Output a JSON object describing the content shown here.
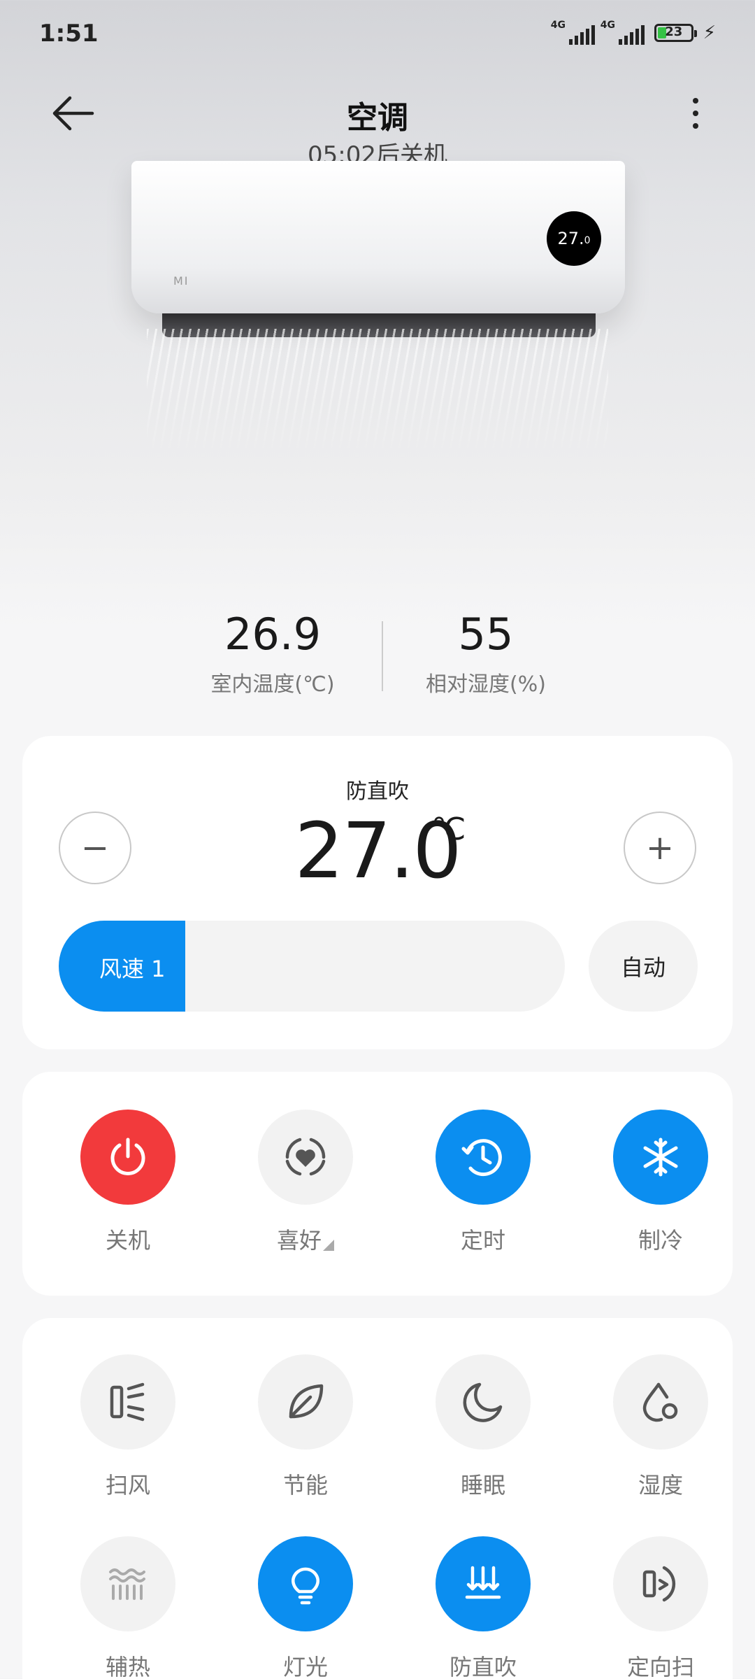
{
  "status_bar": {
    "time": "1:51",
    "signal_label_1": "4G",
    "signal_label_2": "4G",
    "battery": "23"
  },
  "header": {
    "title": "空调",
    "subtitle": "05:02后关机"
  },
  "ac_unit": {
    "brand": "MI",
    "display_temp": "27.",
    "display_temp_decimal": "0"
  },
  "readings": {
    "indoor_temp": {
      "value": "26.9",
      "label": "室内温度(℃)"
    },
    "humidity": {
      "value": "55",
      "label": "相对湿度(%)"
    }
  },
  "temp_control": {
    "mode": "防直吹",
    "temperature": "27.0",
    "unit": "℃",
    "minus": "−",
    "plus": "+",
    "fan_speed_label": "风速 1",
    "fan_speed_fraction": 0.25,
    "auto_label": "自动"
  },
  "quick_actions": [
    {
      "label": "关机",
      "icon": "power-icon",
      "style": "red"
    },
    {
      "label": "喜好",
      "icon": "favorite-icon",
      "style": "gray"
    },
    {
      "label": "定时",
      "icon": "timer-icon",
      "style": "blue"
    },
    {
      "label": "制冷",
      "icon": "snowflake-icon",
      "style": "blue"
    }
  ],
  "modes": [
    {
      "label": "扫风",
      "icon": "swing-icon",
      "active": false
    },
    {
      "label": "节能",
      "icon": "leaf-icon",
      "active": false
    },
    {
      "label": "睡眠",
      "icon": "moon-icon",
      "active": false
    },
    {
      "label": "湿度",
      "icon": "droplet-icon",
      "active": false
    },
    {
      "label": "辅热",
      "icon": "heat-icon",
      "active": false
    },
    {
      "label": "灯光",
      "icon": "bulb-icon",
      "active": true
    },
    {
      "label": "防直吹",
      "icon": "anti-direct-icon",
      "active": true
    },
    {
      "label": "定向扫",
      "icon": "directional-swing-icon",
      "active": false
    }
  ],
  "colors": {
    "accent": "#0b8ef0",
    "power_red": "#f23a3c"
  }
}
